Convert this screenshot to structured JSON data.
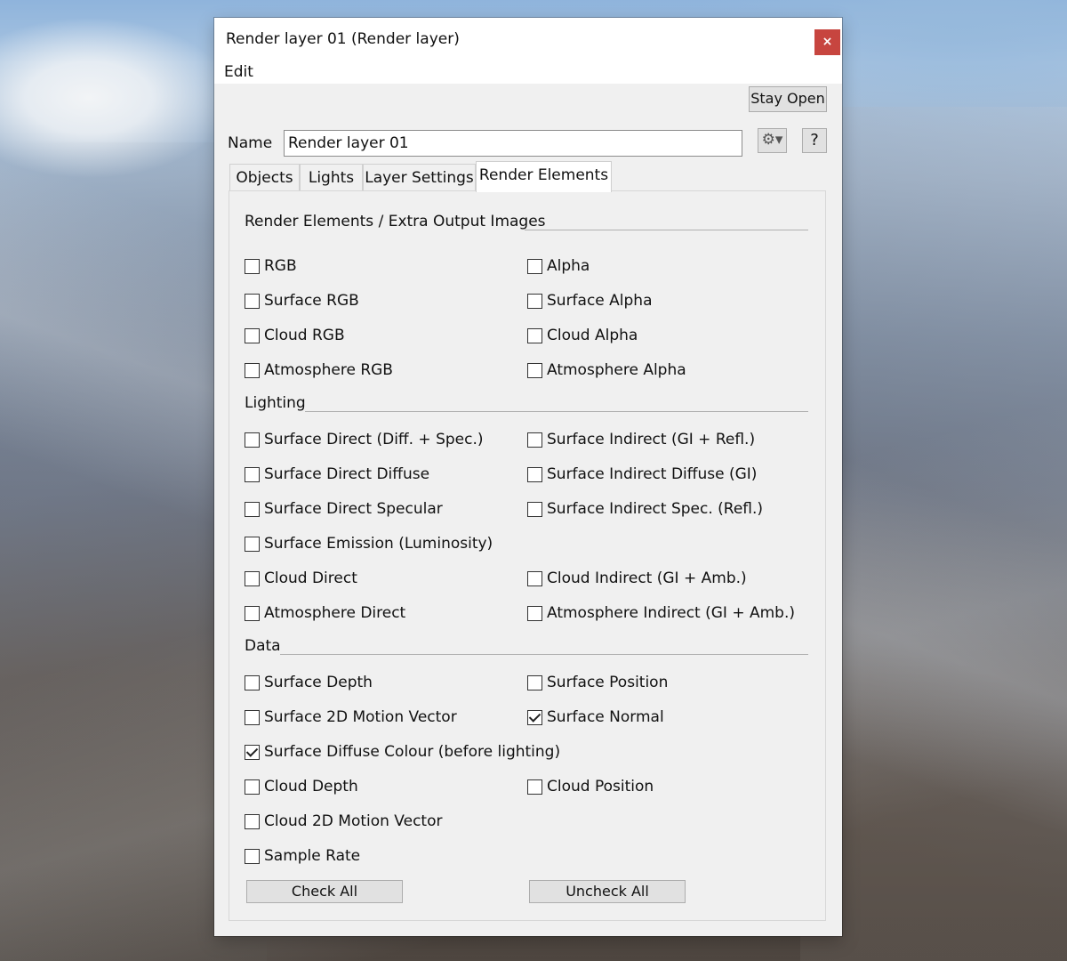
{
  "window": {
    "title": "Render layer 01",
    "type_label": "(Render layer)",
    "close_label": "×",
    "menu_edit": "Edit",
    "stay_open_label": "Stay Open",
    "name_label": "Name",
    "name_value": "Render layer 01",
    "gear_symbol": "⚙▾",
    "help_label": "?"
  },
  "tabs": [
    {
      "label": "Objects",
      "active": false
    },
    {
      "label": "Lights",
      "active": false
    },
    {
      "label": "Layer Settings",
      "active": false
    },
    {
      "label": "Render Elements",
      "active": true
    }
  ],
  "sections": [
    {
      "title": "Render Elements / Extra Output Images"
    },
    {
      "title": "Lighting"
    },
    {
      "title": "Data"
    }
  ],
  "checkboxes": [
    {
      "label": "RGB",
      "checked": false
    },
    {
      "label": "Alpha",
      "checked": false
    },
    {
      "label": "Surface RGB",
      "checked": false
    },
    {
      "label": "Surface Alpha",
      "checked": false
    },
    {
      "label": "Cloud RGB",
      "checked": false
    },
    {
      "label": "Cloud Alpha",
      "checked": false
    },
    {
      "label": "Atmosphere RGB",
      "checked": false
    },
    {
      "label": "Atmosphere Alpha",
      "checked": false
    },
    {
      "label": "Surface Direct (Diff. + Spec.)",
      "checked": false
    },
    {
      "label": "Surface Indirect (GI + Refl.)",
      "checked": false
    },
    {
      "label": "Surface Direct Diffuse",
      "checked": false
    },
    {
      "label": "Surface Indirect Diffuse (GI)",
      "checked": false
    },
    {
      "label": "Surface Direct Specular",
      "checked": false
    },
    {
      "label": "Surface Indirect Spec. (Refl.)",
      "checked": false
    },
    {
      "label": "Surface Emission (Luminosity)",
      "checked": false
    },
    {
      "label": "Cloud Direct",
      "checked": false
    },
    {
      "label": "Cloud Indirect (GI + Amb.)",
      "checked": false
    },
    {
      "label": "Atmosphere Direct",
      "checked": false
    },
    {
      "label": "Atmosphere Indirect (GI + Amb.)",
      "checked": false
    },
    {
      "label": "Surface Depth",
      "checked": false
    },
    {
      "label": "Surface Position",
      "checked": false
    },
    {
      "label": "Surface 2D Motion Vector",
      "checked": false
    },
    {
      "label": "Surface Normal",
      "checked": true
    },
    {
      "label": "Surface Diffuse Colour (before lighting)",
      "checked": true
    },
    {
      "label": "Cloud Depth",
      "checked": false
    },
    {
      "label": "Cloud Position",
      "checked": false
    },
    {
      "label": "Cloud 2D Motion Vector",
      "checked": false
    },
    {
      "label": "Sample Rate",
      "checked": false
    }
  ],
  "buttons": {
    "check_all": "Check All",
    "uncheck_all": "Uncheck All"
  },
  "colors": {
    "close_button": "#c7453f",
    "dialog_bg": "#f0f0f0"
  }
}
